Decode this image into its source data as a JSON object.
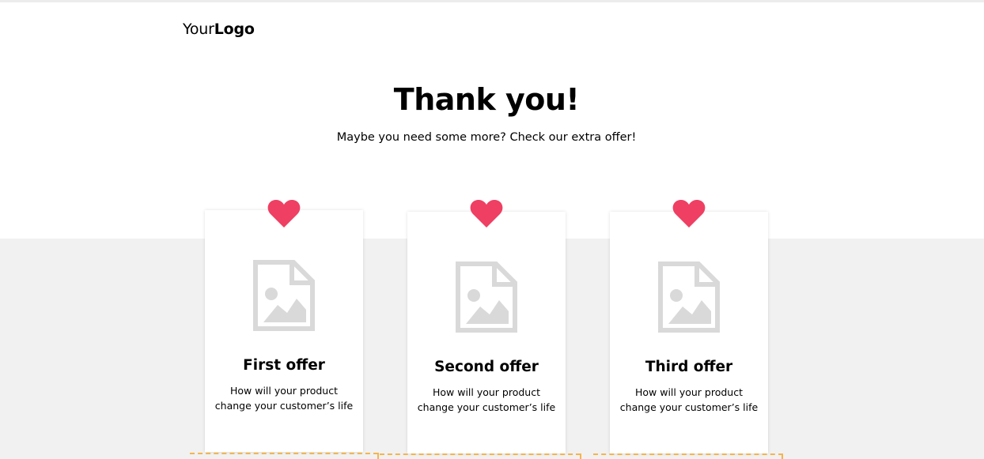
{
  "header": {
    "logo_light": "Your",
    "logo_bold": "Logo"
  },
  "hero": {
    "title": "Thank you!",
    "subtitle": "Maybe you need some more? Check our extra offer!"
  },
  "offers": [
    {
      "title": "First offer",
      "desc_line1": "How will your product",
      "desc_line2": "change your customer’s life"
    },
    {
      "title": "Second offer",
      "desc_line1": "How will your product",
      "desc_line2": "change your customer’s life"
    },
    {
      "title": "Third offer",
      "desc_line1": "How will your product",
      "desc_line2": "change your customer’s life"
    }
  ],
  "icons": {
    "offer_badge": "heart-icon",
    "offer_image": "image-placeholder-icon"
  },
  "colors": {
    "heart": "#ef3f63",
    "placeholder": "#d9d9d9",
    "band_background": "#f1f1f1",
    "dashed_border": "#f4b54c"
  }
}
